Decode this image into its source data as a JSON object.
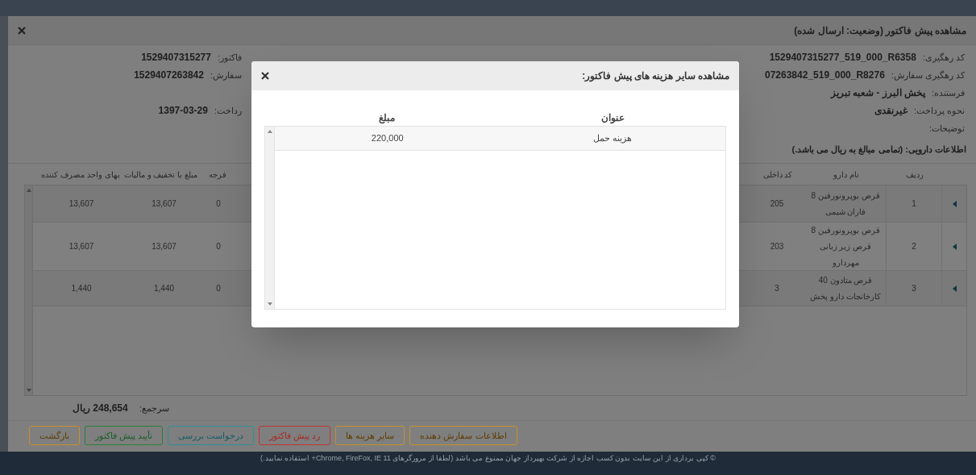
{
  "window": {
    "title": "مشاهده پیش فاکتور (وضعیت: ارسال شده)"
  },
  "info_rows": [
    {
      "right": {
        "label": "کد رهگیری:",
        "value": "1529407315277_519_000_R6358"
      },
      "left": {
        "label": "فاکتور:",
        "value": "1529407315277"
      }
    },
    {
      "right": {
        "label": "کد رهگیری سفارش:",
        "value": "07263842_519_000_R8276"
      },
      "left": {
        "label": "سفارش:",
        "value": "1529407263842"
      }
    },
    {
      "right": {
        "label": "فرستنده:",
        "value": "پخش البرز - شعبه تبریز"
      }
    },
    {
      "right": {
        "label": "نحوه پرداخت:",
        "value": "غیرنقدی"
      },
      "left": {
        "label": "رداخت:",
        "value": "1397-03-29"
      }
    },
    {
      "right": {
        "label": "توضیحات:"
      }
    }
  ],
  "section_title": "اطلاعات دارویی: (تمامی مبالغ به ریال می باشد.)",
  "table": {
    "columns": [
      "ردیف",
      "نام دارو",
      "کد داخلی",
      "فرجه",
      "مبلغ با تخفیف و مالیات",
      "بهای واحد مصرف کننده"
    ],
    "rows": [
      [
        "1",
        "قرص بوپرونورفین 8 فاران شیمی",
        "205",
        "0",
        "13,607",
        "13,607"
      ],
      [
        "2",
        "قرص بوپرونورفین 8 قرص زیر زبانی مهردارو",
        "203",
        "0",
        "13,607",
        "13,607"
      ],
      [
        "3",
        "قرص متادون 40 کارخانجات دارو پخش",
        "3",
        "0",
        "1,440",
        "1,440"
      ]
    ]
  },
  "total": {
    "label": "سرجمع:",
    "value": "248,654 ریال"
  },
  "buttons": [
    {
      "label": "اطلاعات سفارش دهنده",
      "kind": "warning"
    },
    {
      "label": "سایر هزینه ها",
      "kind": "warning"
    },
    {
      "label": "رد پیش فاکتور",
      "kind": "danger"
    },
    {
      "label": "درخواست بررسی",
      "kind": "info"
    },
    {
      "label": "تأیید پیش فاکتور",
      "kind": "success"
    },
    {
      "label": "بازگشت",
      "kind": "warning"
    }
  ],
  "footer": "© کپی برداری از این سایت بدون کسب اجازه از شرکت بهپرداز جهان ممنوع می باشد (لطفا از مرورگرهای Chrome, FireFox, IE 11+ استفاده نمایید.)",
  "dialog": {
    "title": "مشاهده سایر هزینه های پیش فاکتور:",
    "columns": [
      "عنوان",
      "مبلغ"
    ],
    "rows": [
      [
        "هزینه حمل",
        "220,000"
      ]
    ]
  }
}
